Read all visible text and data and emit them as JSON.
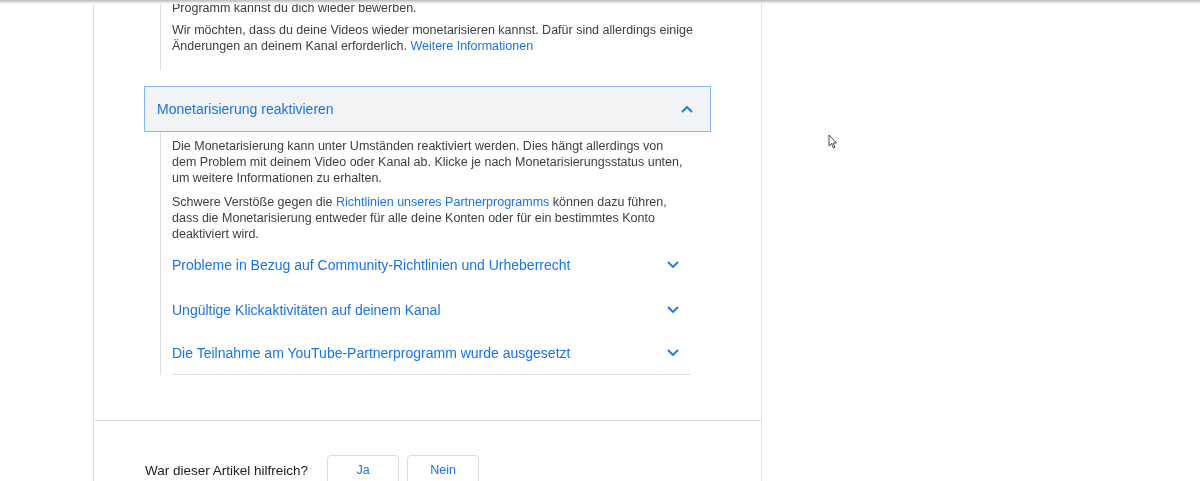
{
  "intro": {
    "paragraphs": [
      {
        "text": "Programm kannst du dich wieder bewerben."
      },
      {
        "text": "Wir möchten, dass du deine Videos wieder monetarisieren kannst. Dafür sind allerdings einige Änderungen an deinem Kanal erforderlich.",
        "link": "Weitere Informationen"
      }
    ]
  },
  "section": {
    "title": "Monetarisierung reaktivieren",
    "expanded": true,
    "paragraphs": [
      {
        "text": "Die Monetarisierung kann unter Umständen reaktiviert werden. Dies hängt allerdings von dem Problem mit deinem Video oder Kanal ab. Klicke je nach Monetarisierungsstatus unten, um weitere Informationen zu erhalten."
      },
      {
        "text": "Schwere Verstöße gegen die",
        "link": "Richtlinien unseres Partnerprogramms",
        "text_after": "können dazu führen, dass die Monetarisierung entweder für alle deine Konten oder für ein bestimmtes Konto deaktiviert wird."
      }
    ],
    "items": [
      {
        "title": "Probleme in Bezug auf Community-Richtlinien und Urheberrecht",
        "expanded": false
      },
      {
        "title": "Ungültige Klickaktivitäten auf deinem Kanal",
        "expanded": false
      },
      {
        "title": "Die Teilnahme am YouTube-Partnerprogramm wurde ausgesetzt",
        "expanded": false
      }
    ]
  },
  "feedback": {
    "question": "War dieser Artikel hilfreich?",
    "buttons": [
      "Ja",
      "Nein"
    ]
  }
}
